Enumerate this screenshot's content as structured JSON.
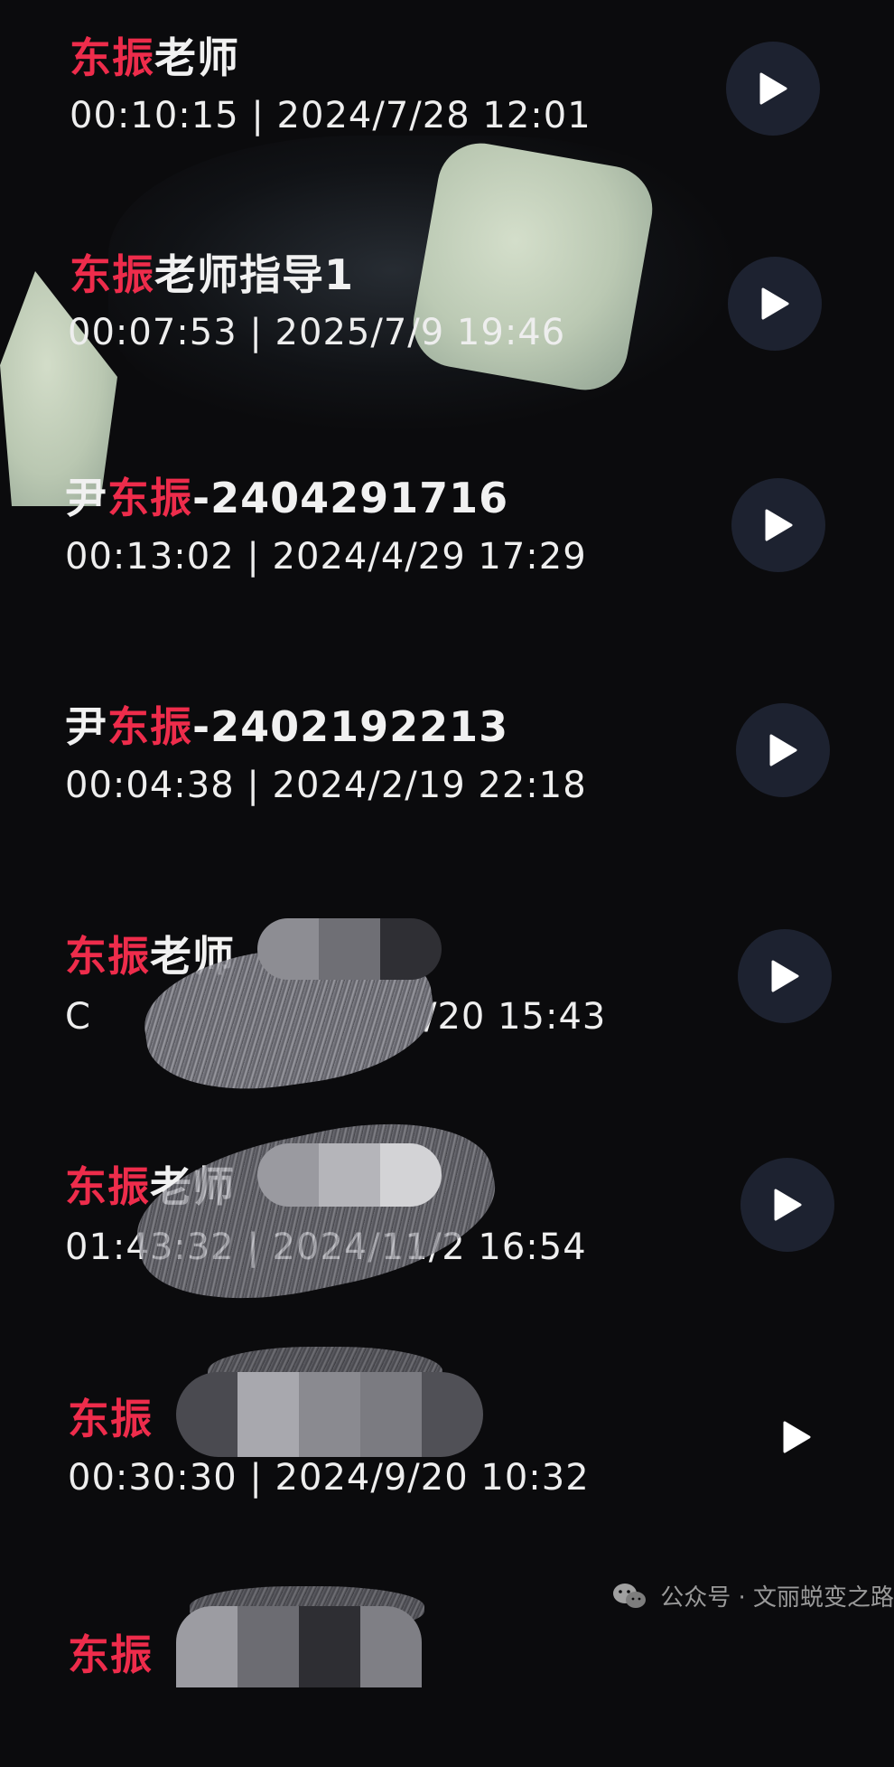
{
  "recordings": [
    {
      "title_red": "东振",
      "title_white": "老师",
      "title_prefix": "",
      "meta": "00:10:15 | 2024/7/28 12:01"
    },
    {
      "title_red": "东振",
      "title_white": "老师指导1",
      "title_prefix": "",
      "meta": "00:07:53 | 2025/7/9 19:46"
    },
    {
      "title_red": "东振",
      "title_white": "-2404291716",
      "title_prefix": "尹",
      "meta": "00:13:02 | 2024/4/29 17:29"
    },
    {
      "title_red": "东振",
      "title_white": "-2402192213",
      "title_prefix": "尹",
      "meta": "00:04:38 | 2024/2/19 22:18"
    },
    {
      "title_red": "东振",
      "title_white": "老师",
      "title_prefix": "",
      "meta_left": "C",
      "meta": "/20 15:43"
    },
    {
      "title_red": "东振",
      "title_white": "老师",
      "title_prefix": "",
      "meta": "01:43:32 | 2024/11/2  16:54"
    },
    {
      "title_red": "东振",
      "title_white": "",
      "title_prefix": "",
      "meta": "00:30:30 | 2024/9/20 10:32"
    },
    {
      "title_red": "东振",
      "title_white": "",
      "title_prefix": "",
      "meta": ""
    }
  ],
  "watermark": {
    "label": "公众号 · 文丽蜕变之路"
  },
  "colors": {
    "accent": "#ee2c4b",
    "background": "#0b0b0d",
    "play_circle": "#1d2230"
  },
  "icons": {
    "play": "play-icon",
    "wechat": "wechat-icon"
  }
}
